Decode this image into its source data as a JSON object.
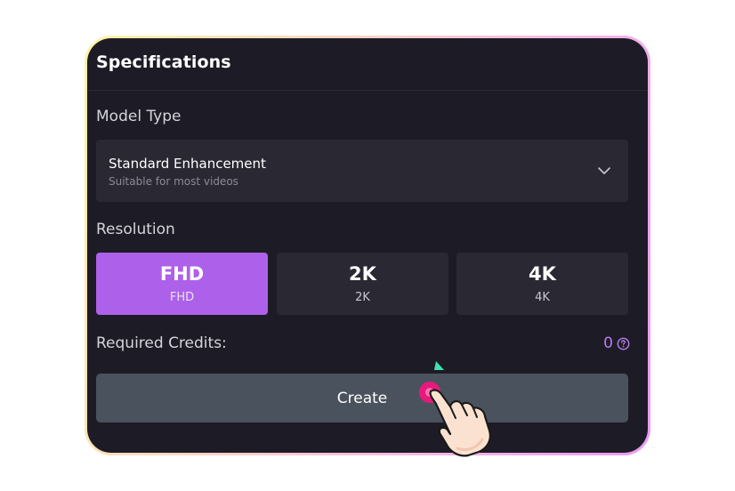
{
  "panel": {
    "title": "Specifications"
  },
  "model_type": {
    "label": "Model Type",
    "selected_name": "Standard Enhancement",
    "selected_description": "Suitable for most videos",
    "icon": "chevron-down-icon"
  },
  "resolution": {
    "label": "Resolution",
    "options": [
      {
        "label": "FHD",
        "sublabel": "FHD",
        "selected": true
      },
      {
        "label": "2K",
        "sublabel": "2K",
        "selected": false
      },
      {
        "label": "4K",
        "sublabel": "4K",
        "selected": false
      }
    ]
  },
  "credits": {
    "label": "Required Credits:",
    "value": "0",
    "icon": "help-circle-icon"
  },
  "create_button": {
    "label": "Create"
  },
  "colors": {
    "panel_bg": "#1d1c26",
    "accent_purple": "#ad61ea",
    "credits_purple": "#b77cf0",
    "option_bg": "#2a2933",
    "button_bg": "#4a535d",
    "cursor_green": "#3ee2b0",
    "tap_pink": "#e8197c"
  },
  "overlay_icons": [
    "pointer-cursor-icon",
    "hand-tap-icon"
  ]
}
